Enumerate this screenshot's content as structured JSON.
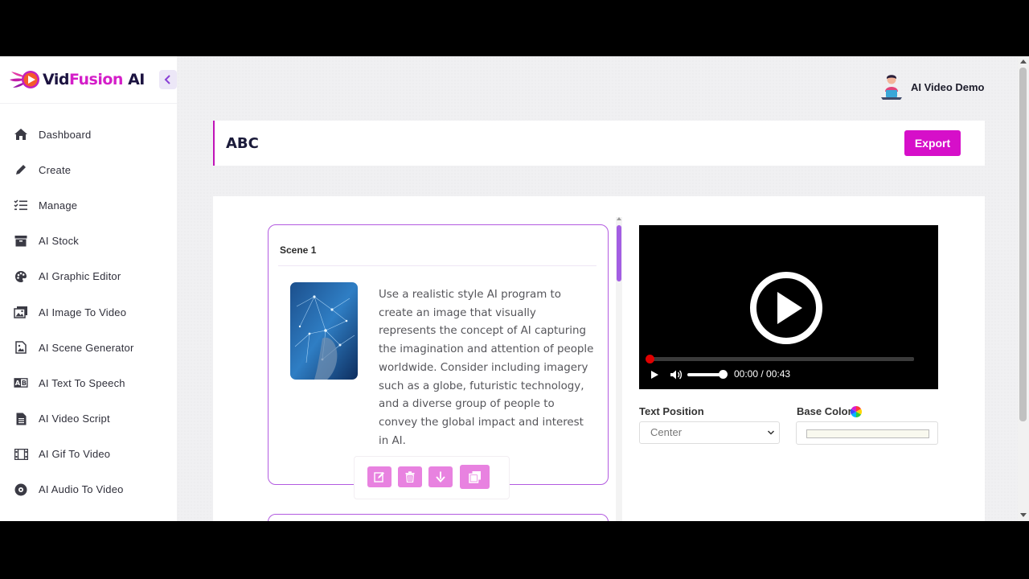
{
  "brand": {
    "part1": "Vid",
    "part2": "Fusion",
    "part3": " AI"
  },
  "user": {
    "name": "AI Video Demo"
  },
  "sidebar": {
    "items": [
      {
        "label": "Dashboard",
        "icon": "home-icon"
      },
      {
        "label": "Create",
        "icon": "pencil-icon"
      },
      {
        "label": "Manage",
        "icon": "checklist-icon"
      },
      {
        "label": "AI Stock",
        "icon": "archive-icon"
      },
      {
        "label": "AI Graphic Editor",
        "icon": "palette-icon"
      },
      {
        "label": "AI Image To Video",
        "icon": "images-icon"
      },
      {
        "label": "AI Scene Generator",
        "icon": "file-image-icon"
      },
      {
        "label": "AI Text To Speech",
        "icon": "text-speech-icon"
      },
      {
        "label": "AI Video Script",
        "icon": "document-icon"
      },
      {
        "label": "AI Gif To Video",
        "icon": "film-icon"
      },
      {
        "label": "AI Audio To Video",
        "icon": "disc-icon"
      }
    ]
  },
  "project": {
    "title": "ABC",
    "export_label": "Export"
  },
  "scene": {
    "title": "Scene 1",
    "text": "Use a realistic style AI program to create an image that visually represents the concept of AI capturing the imagination and attention of people worldwide. Consider including imagery such as a globe, futuristic technology, and a diverse group of people to convey the global impact and interest in AI.",
    "actions": [
      "edit-icon",
      "trash-icon",
      "download-icon",
      "duplicate-icon"
    ]
  },
  "video": {
    "time": "00:00 / 00:43",
    "progress": 0,
    "volume": 0.85
  },
  "settings": {
    "text_position_label": "Text Position",
    "text_position_value": "Center",
    "base_color_label": "Base Color",
    "base_color_value": "#f9f9ef"
  },
  "colors": {
    "accent": "#d60fc9",
    "scene_border": "#b35be0",
    "action_button": "#e882e0"
  }
}
